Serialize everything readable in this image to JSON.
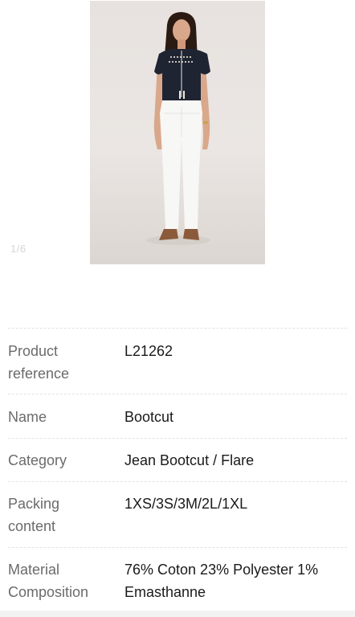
{
  "gallery": {
    "counter": "1/6"
  },
  "product_details": [
    {
      "label": "Product\nreference",
      "value": "L21262"
    },
    {
      "label": "Name",
      "value": "Bootcut"
    },
    {
      "label": "Category",
      "value": "Jean Bootcut / Flare"
    },
    {
      "label": "Packing\ncontent",
      "value": "1XS/3S/3M/2L/1XL"
    },
    {
      "label": "Material\nComposition",
      "value": "76% Coton 23% Polyester 1% Emasthanne"
    }
  ],
  "colors": {
    "label_text": "#6b6b6b",
    "value_text": "#1a1a1a",
    "divider": "#e3e3e3"
  }
}
